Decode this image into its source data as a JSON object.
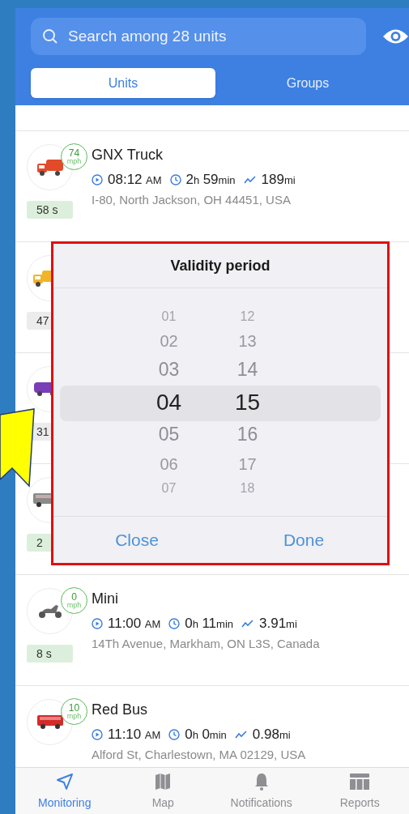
{
  "search": {
    "placeholder": "Search among 28 units"
  },
  "tabs": [
    {
      "label": "Units",
      "selected": true
    },
    {
      "label": "Groups",
      "selected": false
    }
  ],
  "units": [
    {
      "name": "GNX Truck",
      "vehicle": {
        "kind": "truck",
        "color": "#e24a2a"
      },
      "speed": "74",
      "speed_unit": "mph",
      "time": "08:12",
      "time_unit": "AM",
      "duration": [
        {
          "value": "2",
          "unit": "h"
        },
        {
          "value": "59",
          "unit": "min"
        }
      ],
      "distance": {
        "value": "189",
        "unit": "mi"
      },
      "address": "I-80, North Jackson, OH 44451, USA",
      "badge": {
        "text": "58 s",
        "color": "#dcefdc"
      }
    },
    {
      "vehicle": {
        "kind": "truck",
        "color": "#f0b429"
      },
      "badge": {
        "text": "47",
        "color": "#ececec"
      }
    },
    {
      "vehicle": {
        "kind": "van",
        "color": "#7a3db8"
      },
      "badge": {
        "text": "31",
        "color": "#ececec"
      }
    },
    {
      "vehicle": {
        "kind": "bus",
        "color": "#8a8a8a"
      },
      "badge": {
        "text": "2",
        "color": "#dcefdc"
      }
    },
    {
      "name": "Mini",
      "vehicle": {
        "kind": "scooter",
        "color": "#6b6b6b"
      },
      "speed": "0",
      "speed_unit": "mph",
      "time": "11:00",
      "time_unit": "AM",
      "duration": [
        {
          "value": "0",
          "unit": "h"
        },
        {
          "value": "11",
          "unit": "min"
        }
      ],
      "distance": {
        "value": "3.91",
        "unit": "mi"
      },
      "address": "14Th Avenue, Markham, ON L3S, Canada",
      "badge": {
        "text": "8 s",
        "color": "#dcefdc"
      }
    },
    {
      "name": "Red Bus",
      "vehicle": {
        "kind": "bus",
        "color": "#d42a2a"
      },
      "speed": "10",
      "speed_unit": "mph",
      "time": "11:10",
      "time_unit": "AM",
      "duration": [
        {
          "value": "0",
          "unit": "h"
        },
        {
          "value": "0",
          "unit": "min"
        }
      ],
      "distance": {
        "value": "0.98",
        "unit": "mi"
      },
      "address": "Alford St, Charlestown, MA 02129, USA"
    }
  ],
  "dialog": {
    "title": "Validity period",
    "columns": [
      [
        {
          "label": "01",
          "selected": false
        },
        {
          "label": "02",
          "selected": false
        },
        {
          "label": "03",
          "selected": false
        },
        {
          "label": "04",
          "selected": true
        },
        {
          "label": "05",
          "selected": false
        },
        {
          "label": "06",
          "selected": false
        },
        {
          "label": "07",
          "selected": false
        }
      ],
      [
        {
          "label": "12",
          "selected": false
        },
        {
          "label": "13",
          "selected": false
        },
        {
          "label": "14",
          "selected": false
        },
        {
          "label": "15",
          "selected": true
        },
        {
          "label": "16",
          "selected": false
        },
        {
          "label": "17",
          "selected": false
        },
        {
          "label": "18",
          "selected": false
        }
      ]
    ],
    "buttons": [
      "Close",
      "Done"
    ]
  },
  "tab_bar": [
    {
      "label": "Monitoring",
      "kind": "monitoring",
      "selected": true
    },
    {
      "label": "Map",
      "kind": "map",
      "selected": false
    },
    {
      "label": "Notifications",
      "kind": "notifications",
      "selected": false
    },
    {
      "label": "Reports",
      "kind": "reports",
      "selected": false
    }
  ]
}
